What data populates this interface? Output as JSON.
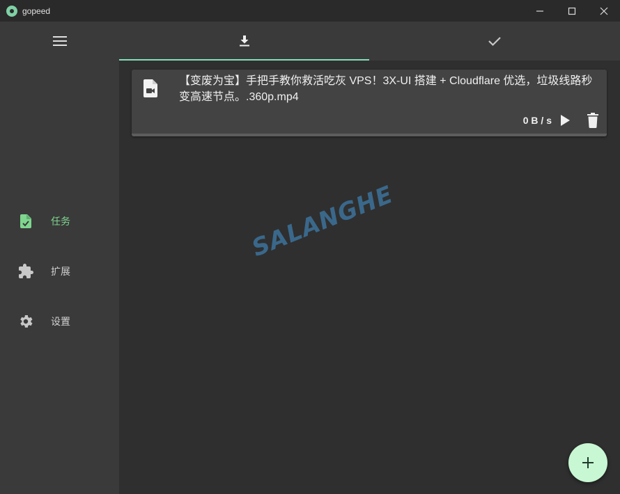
{
  "window": {
    "title": "gopeed",
    "controls": {
      "minimize": "minimize-icon",
      "maximize": "maximize-icon",
      "close": "close-icon"
    }
  },
  "sidebar": {
    "menu_icon": "menu-icon",
    "items": [
      {
        "label": "任务",
        "icon": "task-file-check-icon",
        "active": true
      },
      {
        "label": "扩展",
        "icon": "puzzle-icon",
        "active": false
      },
      {
        "label": "设置",
        "icon": "gear-icon",
        "active": false
      }
    ]
  },
  "tabs": [
    {
      "name": "downloading",
      "icon": "download-icon",
      "active": true
    },
    {
      "name": "done",
      "icon": "check-icon",
      "active": false
    }
  ],
  "tasks": [
    {
      "name": "【变废为宝】手把手教你救活吃灰 VPS！3X-UI 搭建 + Cloudflare 优选，垃圾线路秒变高速节点。.360p.mp4",
      "file_icon": "video-file-icon",
      "speed": "0 B / s",
      "progress": 0
    }
  ],
  "watermark": "SALANGHE",
  "fab": {
    "icon": "add-icon"
  },
  "colors": {
    "accent": "#7fe0b8",
    "active_nav": "#7fd68f",
    "fab_bg": "#c8f7d3",
    "sidebar_bg": "#3a3a3a",
    "main_bg": "#2f2f2f",
    "card_bg": "#434343"
  }
}
